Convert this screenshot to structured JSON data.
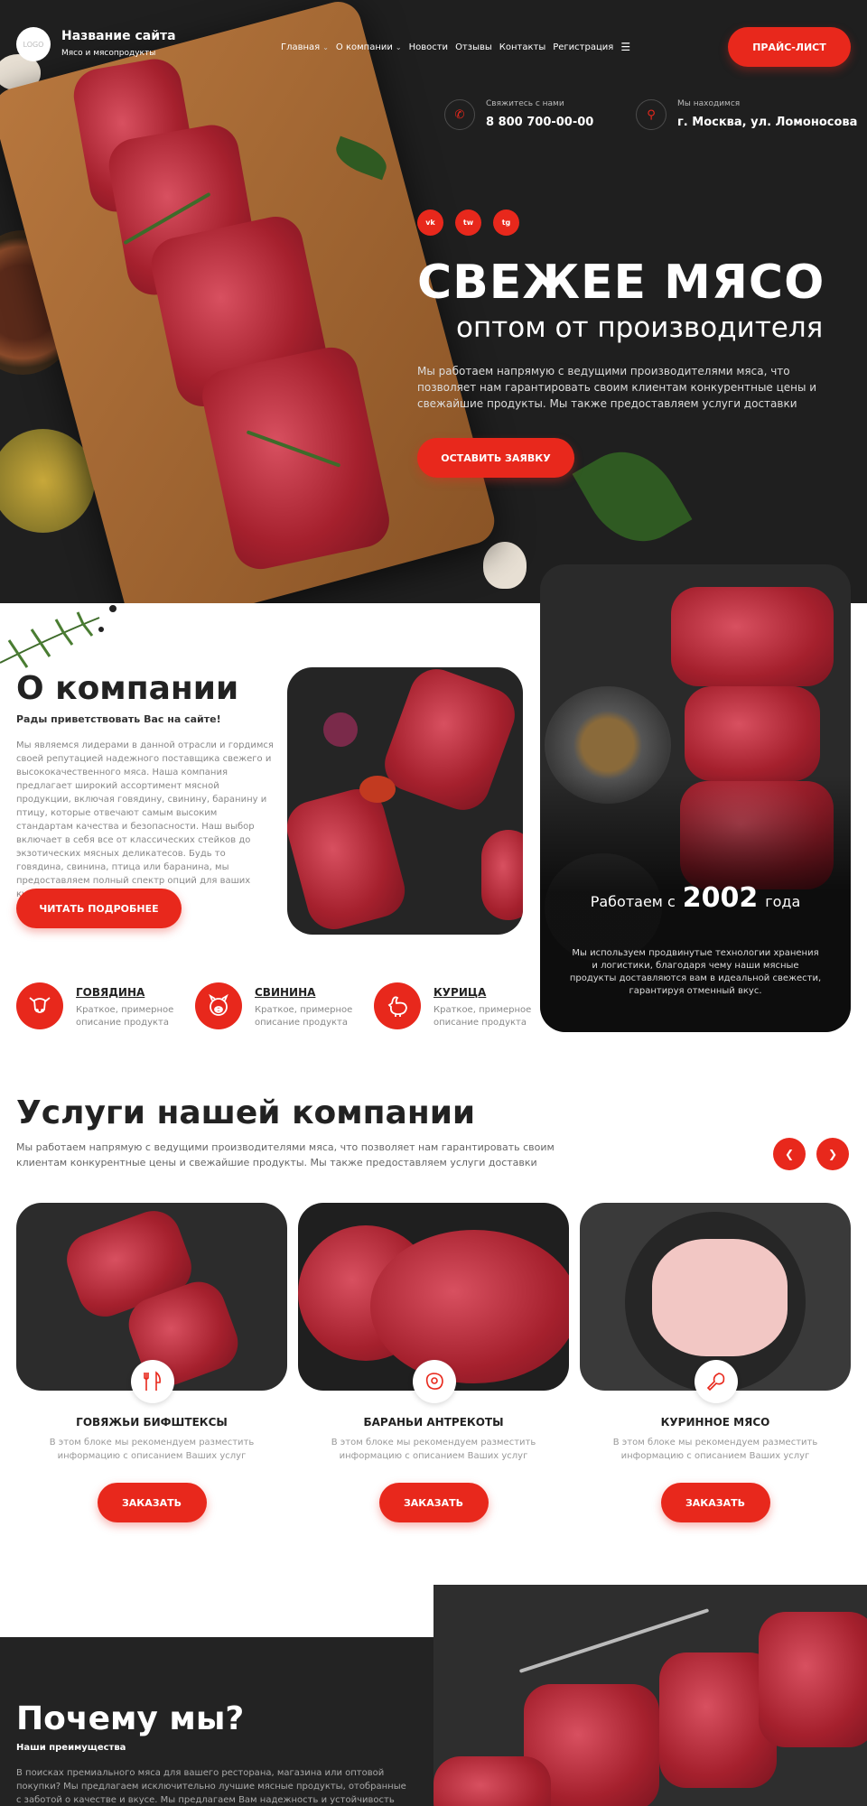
{
  "header": {
    "logo": "LOGO",
    "site_name": "Название сайта",
    "site_sub": "Мясо и мясопродукты",
    "nav": [
      "Главная",
      "О компании",
      "Новости",
      "Отзывы",
      "Контакты",
      "Регистрация"
    ],
    "price_button": "ПРАЙС-ЛИСТ",
    "contact_phone_label": "Свяжитесь с нами",
    "contact_phone": "8 800 700-00-00",
    "contact_addr_label": "Мы находимся",
    "contact_addr": "г. Москва, ул. Ломоносова"
  },
  "hero": {
    "socials": [
      "vk",
      "tw",
      "tg"
    ],
    "title": "СВЕЖЕЕ МЯСО",
    "subtitle": "оптом от производителя",
    "text": "Мы работаем напрямую с ведущими производителями мяса, что позволяет нам гарантировать своим клиентам конкурентные цены и свежайшие продукты. Мы также предоставляем услуги доставки",
    "button": "ОСТАВИТЬ ЗАЯВКУ"
  },
  "about": {
    "title": "О компании",
    "subtitle": "Рады приветствовать Вас на сайте!",
    "text": "Мы являемся лидерами в данной отрасли и гордимся своей репутацией надежного поставщика свежего и высококачественного мяса. Наша компания предлагает широкий ассортимент мясной продукции, включая говядину, свинину, баранину и птицу, которые отвечают самым высоким стандартам качества и безопасности. Наш выбор включает в себя все от классических стейков до экзотических мясных деликатесов. Будь то говядина, свинина, птица или баранина, мы предоставляем полный спектр опций для ваших кулинарных потребностей.",
    "button": "ЧИТАТЬ ПОДРОБНЕЕ",
    "year_prefix": "Работаем с",
    "year": "2002",
    "year_suffix": "года",
    "year_desc": "Мы используем продвинутые технологии хранения и логистики, благодаря чему наши мясные продукты доставляются вам в идеальной свежести, гарантируя отменный вкус.",
    "categories": [
      {
        "name": "ГОВЯДИНА",
        "desc": "Краткое, примерное описание продукта",
        "icon": "cow-icon"
      },
      {
        "name": "СВИНИНА",
        "desc": "Краткое, примерное описание продукта",
        "icon": "pig-icon"
      },
      {
        "name": "КУРИЦА",
        "desc": "Краткое, примерное описание продукта",
        "icon": "chicken-icon"
      }
    ]
  },
  "services": {
    "title": "Услуги нашей компании",
    "text": "Мы работаем напрямую с ведущими производителями мяса, что позволяет нам гарантировать своим клиентам конкурентные цены и свежайшие продукты. Мы также предоставляем услуги доставки",
    "items": [
      {
        "name": "ГОВЯЖЬИ БИФШТЕКСЫ",
        "desc": "В этом блоке мы рекомендуем разместить информацию с описанием Ваших услуг",
        "button": "ЗАКАЗАТЬ"
      },
      {
        "name": "БАРАНЬИ АНТРЕКОТЫ",
        "desc": "В этом блоке мы рекомендуем разместить информацию с описанием Ваших услуг",
        "button": "ЗАКАЗАТЬ"
      },
      {
        "name": "КУРИННОЕ МЯСО",
        "desc": "В этом блоке мы рекомендуем разместить информацию с описанием Ваших услуг",
        "button": "ЗАКАЗАТЬ"
      }
    ]
  },
  "why": {
    "title": "Почему мы?",
    "subtitle": "Наши преимущества",
    "text": "В поисках премиального мяса для вашего ресторана, магазина или оптовой покупки? Мы предлагаем исключительно лучшие мясные продукты, отобранные с заботой о качестве и вкусе. Мы предлагаем Вам надежность и устойчивость вкусовых качеств"
  },
  "colors": {
    "accent": "#e8281c",
    "dark": "#232323"
  }
}
